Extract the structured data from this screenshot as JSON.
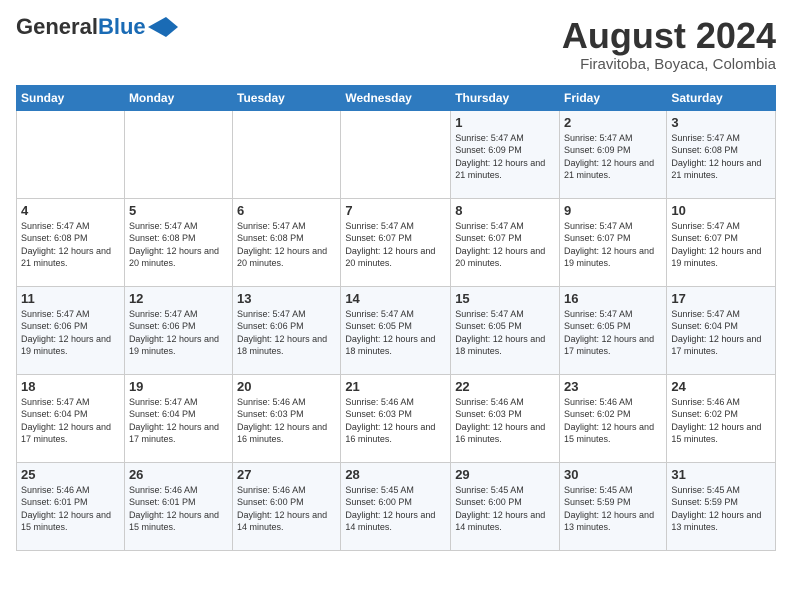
{
  "header": {
    "logo_general": "General",
    "logo_blue": "Blue",
    "month_year": "August 2024",
    "location": "Firavitoba, Boyaca, Colombia"
  },
  "calendar": {
    "days_of_week": [
      "Sunday",
      "Monday",
      "Tuesday",
      "Wednesday",
      "Thursday",
      "Friday",
      "Saturday"
    ],
    "weeks": [
      [
        {
          "day": "",
          "info": ""
        },
        {
          "day": "",
          "info": ""
        },
        {
          "day": "",
          "info": ""
        },
        {
          "day": "",
          "info": ""
        },
        {
          "day": "1",
          "info": "Sunrise: 5:47 AM\nSunset: 6:09 PM\nDaylight: 12 hours\nand 21 minutes."
        },
        {
          "day": "2",
          "info": "Sunrise: 5:47 AM\nSunset: 6:09 PM\nDaylight: 12 hours\nand 21 minutes."
        },
        {
          "day": "3",
          "info": "Sunrise: 5:47 AM\nSunset: 6:08 PM\nDaylight: 12 hours\nand 21 minutes."
        }
      ],
      [
        {
          "day": "4",
          "info": "Sunrise: 5:47 AM\nSunset: 6:08 PM\nDaylight: 12 hours\nand 21 minutes."
        },
        {
          "day": "5",
          "info": "Sunrise: 5:47 AM\nSunset: 6:08 PM\nDaylight: 12 hours\nand 20 minutes."
        },
        {
          "day": "6",
          "info": "Sunrise: 5:47 AM\nSunset: 6:08 PM\nDaylight: 12 hours\nand 20 minutes."
        },
        {
          "day": "7",
          "info": "Sunrise: 5:47 AM\nSunset: 6:07 PM\nDaylight: 12 hours\nand 20 minutes."
        },
        {
          "day": "8",
          "info": "Sunrise: 5:47 AM\nSunset: 6:07 PM\nDaylight: 12 hours\nand 20 minutes."
        },
        {
          "day": "9",
          "info": "Sunrise: 5:47 AM\nSunset: 6:07 PM\nDaylight: 12 hours\nand 19 minutes."
        },
        {
          "day": "10",
          "info": "Sunrise: 5:47 AM\nSunset: 6:07 PM\nDaylight: 12 hours\nand 19 minutes."
        }
      ],
      [
        {
          "day": "11",
          "info": "Sunrise: 5:47 AM\nSunset: 6:06 PM\nDaylight: 12 hours\nand 19 minutes."
        },
        {
          "day": "12",
          "info": "Sunrise: 5:47 AM\nSunset: 6:06 PM\nDaylight: 12 hours\nand 19 minutes."
        },
        {
          "day": "13",
          "info": "Sunrise: 5:47 AM\nSunset: 6:06 PM\nDaylight: 12 hours\nand 18 minutes."
        },
        {
          "day": "14",
          "info": "Sunrise: 5:47 AM\nSunset: 6:05 PM\nDaylight: 12 hours\nand 18 minutes."
        },
        {
          "day": "15",
          "info": "Sunrise: 5:47 AM\nSunset: 6:05 PM\nDaylight: 12 hours\nand 18 minutes."
        },
        {
          "day": "16",
          "info": "Sunrise: 5:47 AM\nSunset: 6:05 PM\nDaylight: 12 hours\nand 17 minutes."
        },
        {
          "day": "17",
          "info": "Sunrise: 5:47 AM\nSunset: 6:04 PM\nDaylight: 12 hours\nand 17 minutes."
        }
      ],
      [
        {
          "day": "18",
          "info": "Sunrise: 5:47 AM\nSunset: 6:04 PM\nDaylight: 12 hours\nand 17 minutes."
        },
        {
          "day": "19",
          "info": "Sunrise: 5:47 AM\nSunset: 6:04 PM\nDaylight: 12 hours\nand 17 minutes."
        },
        {
          "day": "20",
          "info": "Sunrise: 5:46 AM\nSunset: 6:03 PM\nDaylight: 12 hours\nand 16 minutes."
        },
        {
          "day": "21",
          "info": "Sunrise: 5:46 AM\nSunset: 6:03 PM\nDaylight: 12 hours\nand 16 minutes."
        },
        {
          "day": "22",
          "info": "Sunrise: 5:46 AM\nSunset: 6:03 PM\nDaylight: 12 hours\nand 16 minutes."
        },
        {
          "day": "23",
          "info": "Sunrise: 5:46 AM\nSunset: 6:02 PM\nDaylight: 12 hours\nand 15 minutes."
        },
        {
          "day": "24",
          "info": "Sunrise: 5:46 AM\nSunset: 6:02 PM\nDaylight: 12 hours\nand 15 minutes."
        }
      ],
      [
        {
          "day": "25",
          "info": "Sunrise: 5:46 AM\nSunset: 6:01 PM\nDaylight: 12 hours\nand 15 minutes."
        },
        {
          "day": "26",
          "info": "Sunrise: 5:46 AM\nSunset: 6:01 PM\nDaylight: 12 hours\nand 15 minutes."
        },
        {
          "day": "27",
          "info": "Sunrise: 5:46 AM\nSunset: 6:00 PM\nDaylight: 12 hours\nand 14 minutes."
        },
        {
          "day": "28",
          "info": "Sunrise: 5:45 AM\nSunset: 6:00 PM\nDaylight: 12 hours\nand 14 minutes."
        },
        {
          "day": "29",
          "info": "Sunrise: 5:45 AM\nSunset: 6:00 PM\nDaylight: 12 hours\nand 14 minutes."
        },
        {
          "day": "30",
          "info": "Sunrise: 5:45 AM\nSunset: 5:59 PM\nDaylight: 12 hours\nand 13 minutes."
        },
        {
          "day": "31",
          "info": "Sunrise: 5:45 AM\nSunset: 5:59 PM\nDaylight: 12 hours\nand 13 minutes."
        }
      ]
    ]
  }
}
